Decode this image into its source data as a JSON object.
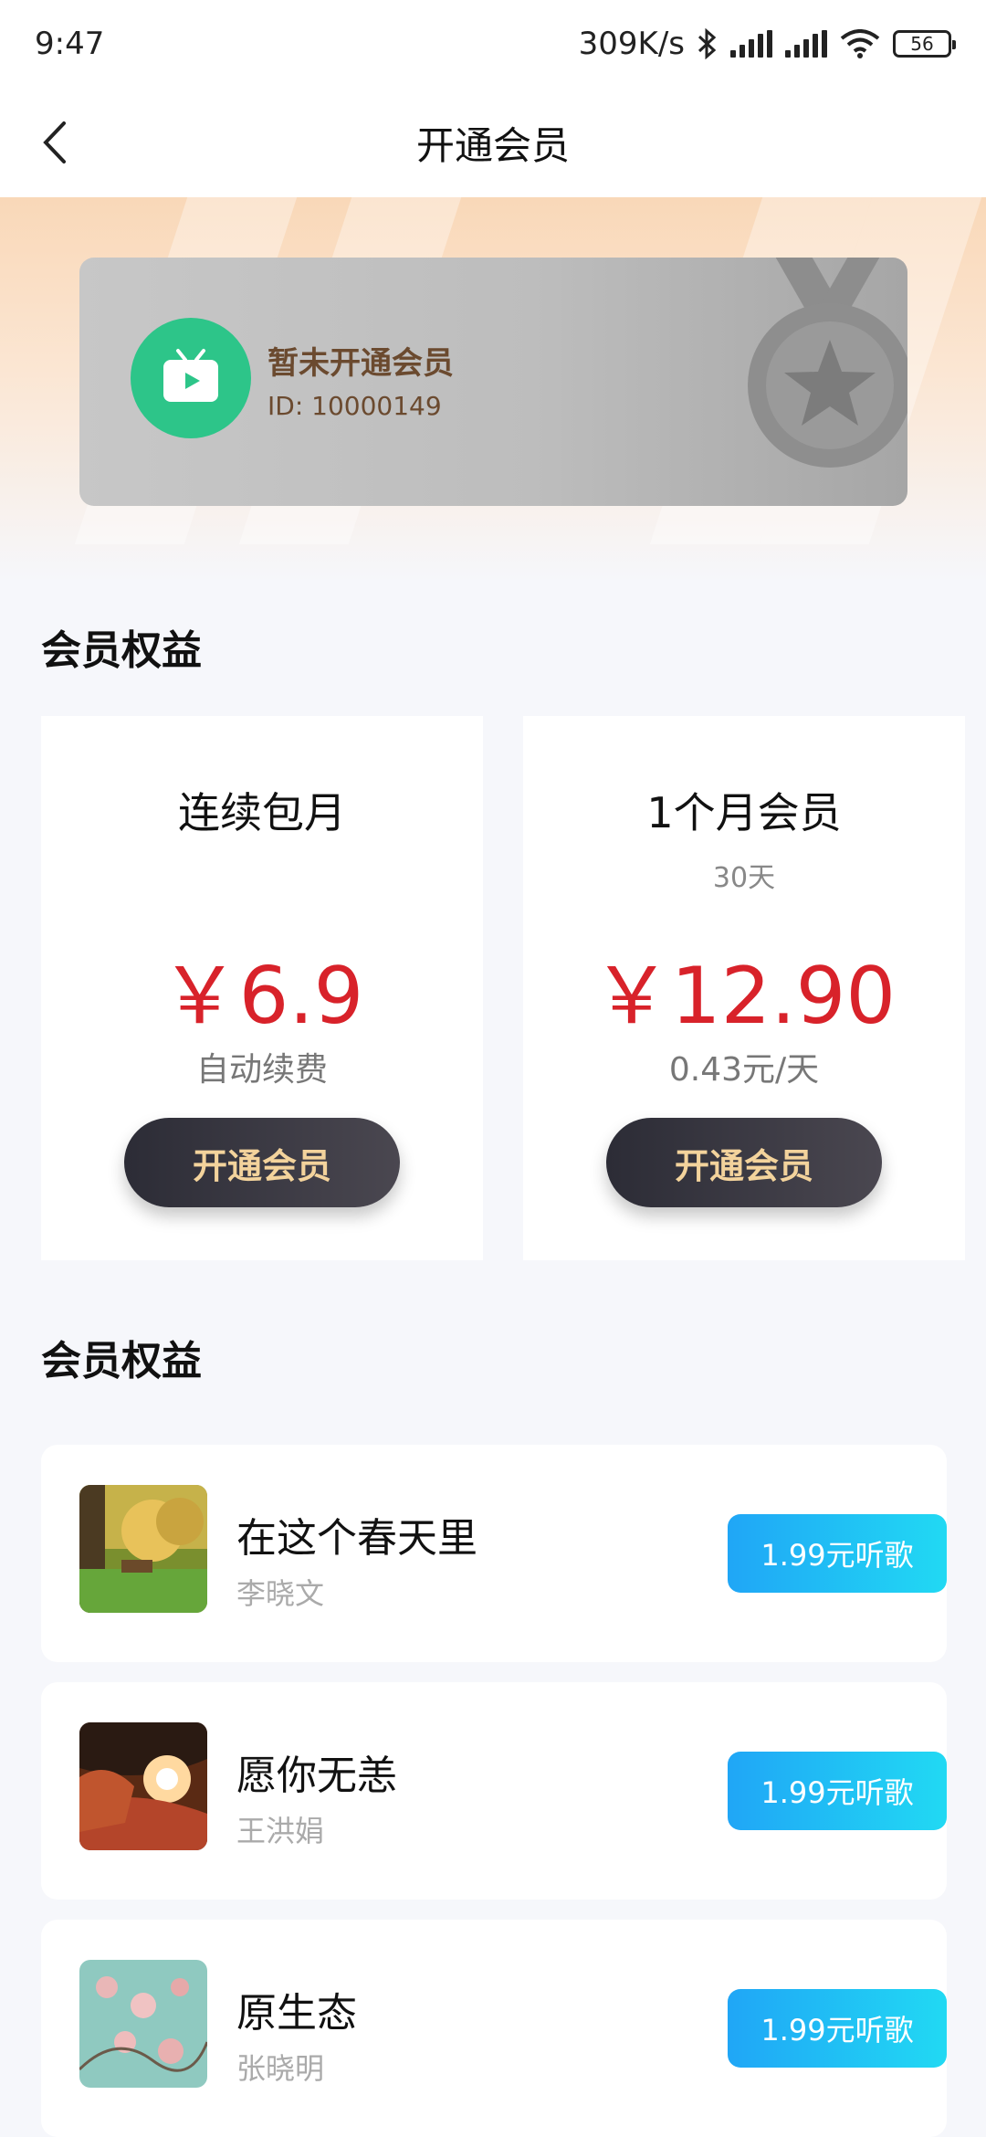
{
  "status_bar": {
    "time": "9:47",
    "net_speed": "309K/s",
    "battery": "56"
  },
  "nav": {
    "title": "开通会员"
  },
  "member_card": {
    "name": "暂未开通会员",
    "id_text": "ID: 10000149"
  },
  "section_benefits_1": "会员权益",
  "plans": [
    {
      "name": "连续包月",
      "sub": "",
      "price": "￥6.9",
      "note": "自动续费",
      "button": "开通会员"
    },
    {
      "name": "1个月会员",
      "sub": "30天",
      "price": "￥12.90",
      "note": "0.43元/天",
      "button": "开通会员"
    }
  ],
  "section_benefits_2": "会员权益",
  "songs": [
    {
      "title": "在这个春天里",
      "artist": "李晓文",
      "button": "1.99元听歌"
    },
    {
      "title": "愿你无恙",
      "artist": "王洪娟",
      "button": "1.99元听歌"
    },
    {
      "title": "原生态",
      "artist": "张晓明",
      "button": "1.99元听歌"
    }
  ],
  "colors": {
    "price_red": "#d8222a",
    "button_gold_text": "#f3d39c",
    "song_button_blue": "#20a6f6",
    "avatar_green": "#2dc589"
  }
}
